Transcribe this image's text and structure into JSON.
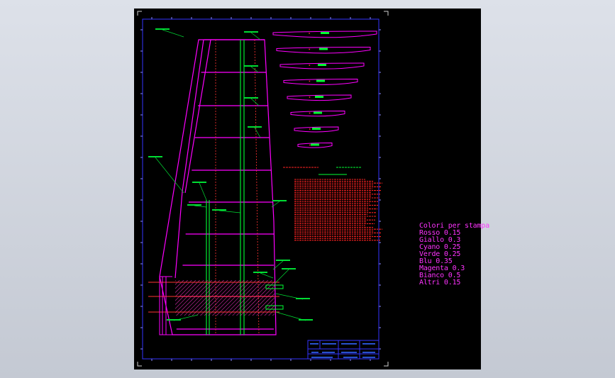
{
  "legend": {
    "title": "Colori per stampa",
    "items": [
      "Rosso 0.15",
      "Giallo 0.3",
      "Cyano 0.25",
      "Verde 0.25",
      "Blu 0.35",
      "Magenta 0.3",
      "Bianco 0.5",
      "Altri 0.15"
    ]
  },
  "colors": {
    "sheet_background": "#000000",
    "border": "#3333ff",
    "structure": "#ff00ff",
    "centerlines": "#ff3333",
    "stringers": "#00ff33",
    "annotations": "#00ff00",
    "notes": "#ff2222",
    "hatch": "#ff33cc"
  },
  "profiles": {
    "count": 8
  }
}
